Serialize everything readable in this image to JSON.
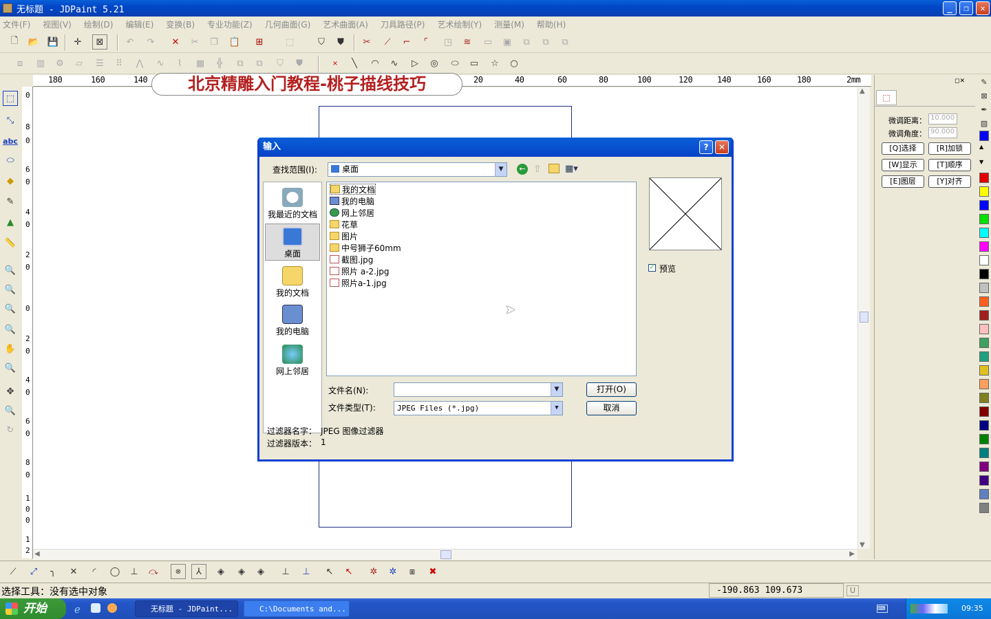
{
  "window": {
    "title": "无标题 - JDPaint 5.21"
  },
  "menu": [
    "文件(F)",
    "视图(V)",
    "绘制(D)",
    "编辑(E)",
    "变换(B)",
    "专业功能(Z)",
    "几何曲面(G)",
    "艺术曲面(A)",
    "刀具路径(P)",
    "艺术绘制(Y)",
    "测量(M)",
    "帮助(H)"
  ],
  "ruler": {
    "unit": "2mm",
    "h_labels": [
      "180",
      "160",
      "140",
      "20",
      "40",
      "60",
      "80",
      "100",
      "120",
      "140",
      "160",
      "180"
    ],
    "v_labels": [
      "0",
      "8",
      "0",
      "6",
      "0",
      "4",
      "0",
      "2",
      "0",
      "0",
      "2",
      "0",
      "4",
      "0",
      "6",
      "0",
      "8",
      "0",
      "1",
      "0",
      "0",
      "1",
      "2"
    ]
  },
  "banner": "北京精雕入门教程-桃子描线技巧",
  "right_panel": {
    "fine_dist_label": "微调距离：",
    "fine_dist_value": "10.000",
    "fine_angle_label": "微调角度：",
    "fine_angle_value": "90.000",
    "buttons": [
      "[Q]选择",
      "[R]加锁",
      "[W]显示",
      "[T]顺序",
      "[E]图层",
      "[Y]对齐"
    ]
  },
  "palette": [
    "#e00000",
    "#ffff00",
    "#0000ff",
    "#00e000",
    "#00ffff",
    "#ff00ff",
    "#ffffff",
    "#000000",
    "#c0c0c0",
    "#ff6020",
    "#a02020",
    "#ffc0c0",
    "#40a060",
    "#20a080",
    "#e0c020",
    "#ffa060",
    "#808020",
    "#800000",
    "#000080",
    "#008000",
    "#008080",
    "#800080",
    "#400080",
    "#6080c0",
    "#808080"
  ],
  "dialog": {
    "title": "输入",
    "lookin_label": "查找范围(I):",
    "lookin_value": "桌面",
    "places": [
      "我最近的文档",
      "桌面",
      "我的文档",
      "我的电脑",
      "网上邻居"
    ],
    "files": [
      {
        "name": "我的文档",
        "type": "folder"
      },
      {
        "name": "我的电脑",
        "type": "pc"
      },
      {
        "name": "网上邻居",
        "type": "net"
      },
      {
        "name": "花草",
        "type": "folder"
      },
      {
        "name": "图片",
        "type": "folder"
      },
      {
        "name": "中号狮子60mm",
        "type": "folder"
      },
      {
        "name": "截图.jpg",
        "type": "img"
      },
      {
        "name": "照片 a-2.jpg",
        "type": "img"
      },
      {
        "name": "照片a-1.jpg",
        "type": "img"
      }
    ],
    "filename_label": "文件名(N):",
    "filename_value": "",
    "filetype_label": "文件类型(T):",
    "filetype_value": "JPEG Files (*.jpg)",
    "open_label": "打开(O)",
    "cancel_label": "取消",
    "preview_label": "预览",
    "preview_checked": true,
    "filter_name_label": "过滤器名字：",
    "filter_name_value": "JPEG 图像过滤器",
    "filter_ver_label": "过滤器版本：",
    "filter_ver_value": "1"
  },
  "status": {
    "left": "选择工具：没有选中对象",
    "coords": "-190.863  109.673",
    "mode": "U"
  },
  "taskbar": {
    "start": "开始",
    "tasks": [
      "无标题 - JDPaint...",
      "C:\\Documents and..."
    ],
    "clock": "09:35"
  }
}
